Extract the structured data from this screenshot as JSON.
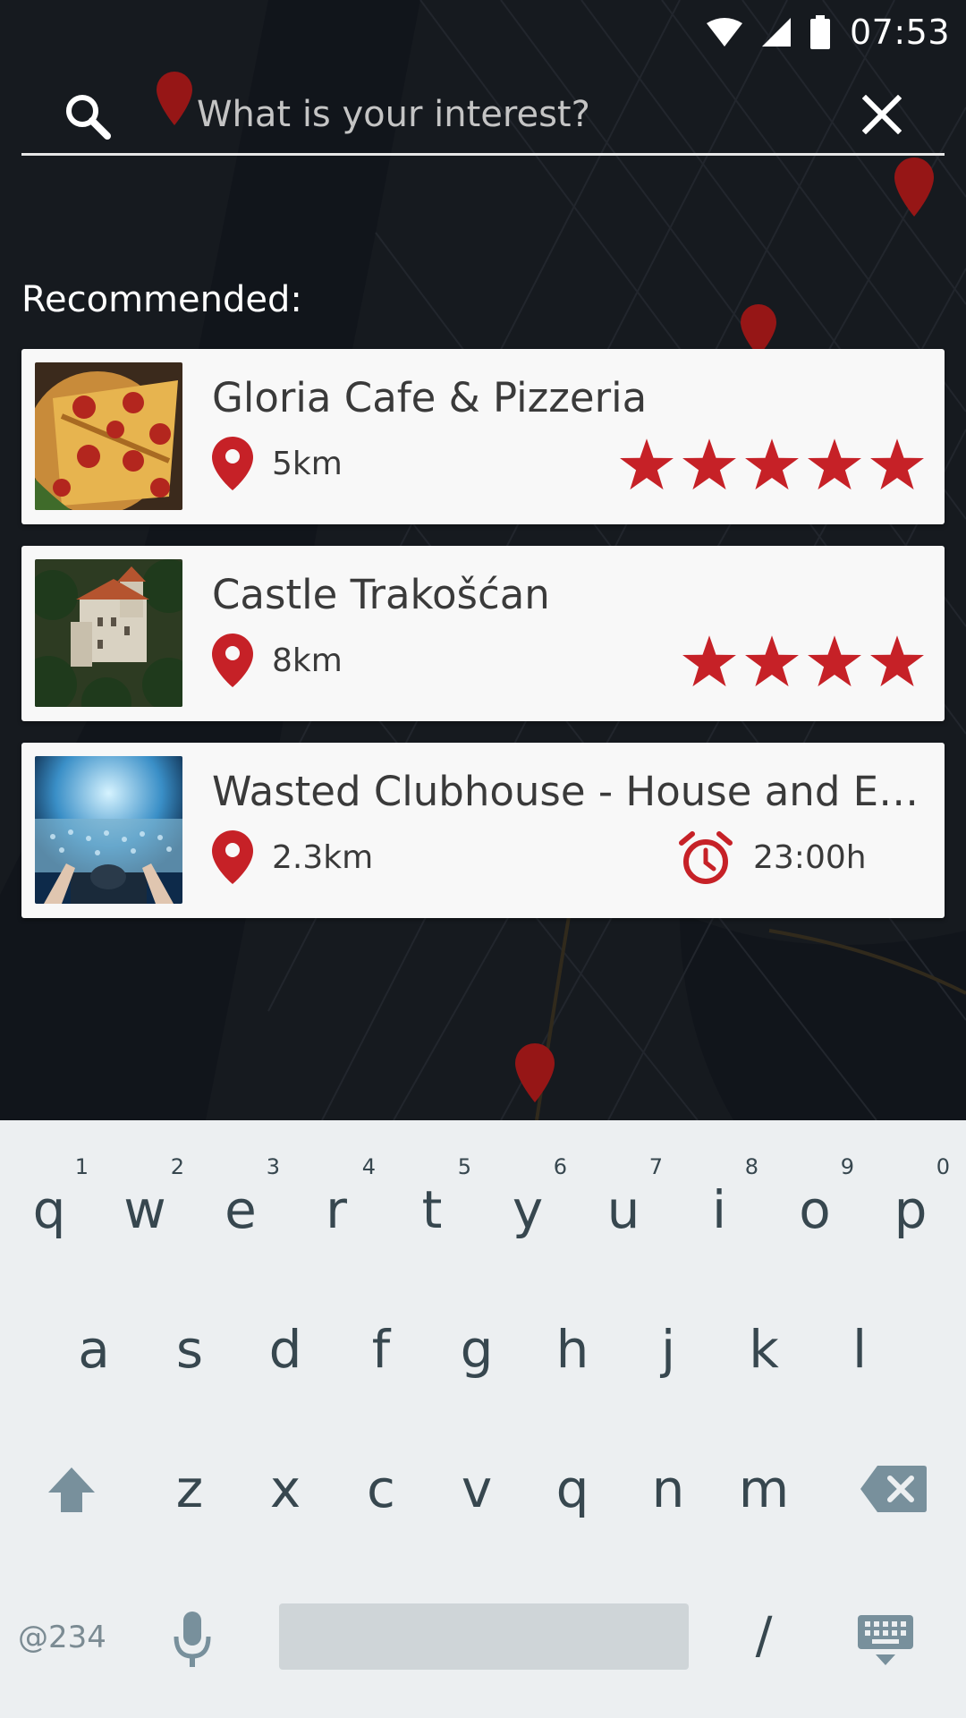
{
  "status_bar": {
    "time": "07:53",
    "icons": [
      "wifi-icon",
      "cell-signal-icon",
      "battery-icon"
    ]
  },
  "search": {
    "placeholder": "What is your interest?",
    "value": "",
    "icon": "search-icon",
    "clear_icon": "close-icon"
  },
  "recommended": {
    "title": "Recommended:",
    "items": [
      {
        "name": "Gloria Cafe & Pizzeria",
        "distance": "5km",
        "rating": 5,
        "thumbnail": "pizza"
      },
      {
        "name": "Castle Trakošćan",
        "distance": "8km",
        "rating": 4,
        "thumbnail": "castle"
      },
      {
        "name": "Wasted Clubhouse - House and Ele...",
        "distance": "2.3km",
        "time": "23:00h",
        "thumbnail": "concert"
      }
    ]
  },
  "keyboard": {
    "row1": [
      {
        "key": "q",
        "hint": "1"
      },
      {
        "key": "w",
        "hint": "2"
      },
      {
        "key": "e",
        "hint": "3"
      },
      {
        "key": "r",
        "hint": "4"
      },
      {
        "key": "t",
        "hint": "5"
      },
      {
        "key": "y",
        "hint": "6"
      },
      {
        "key": "u",
        "hint": "7"
      },
      {
        "key": "i",
        "hint": "8"
      },
      {
        "key": "o",
        "hint": "9"
      },
      {
        "key": "p",
        "hint": "0"
      }
    ],
    "row2": [
      "a",
      "s",
      "d",
      "f",
      "g",
      "h",
      "j",
      "k",
      "l"
    ],
    "row3": [
      "z",
      "x",
      "c",
      "v",
      "q",
      "n",
      "m"
    ],
    "symbols_label": "@234",
    "slash_label": "/",
    "shift_icon": "shift-icon",
    "backspace_icon": "backspace-icon",
    "mic_icon": "microphone-icon",
    "hide_icon": "keyboard-hide-icon"
  },
  "colors": {
    "accent": "#c62127",
    "card_bg": "#f8f8f8",
    "keyboard_bg": "#eceff1",
    "map_bg": "#1c2027"
  }
}
